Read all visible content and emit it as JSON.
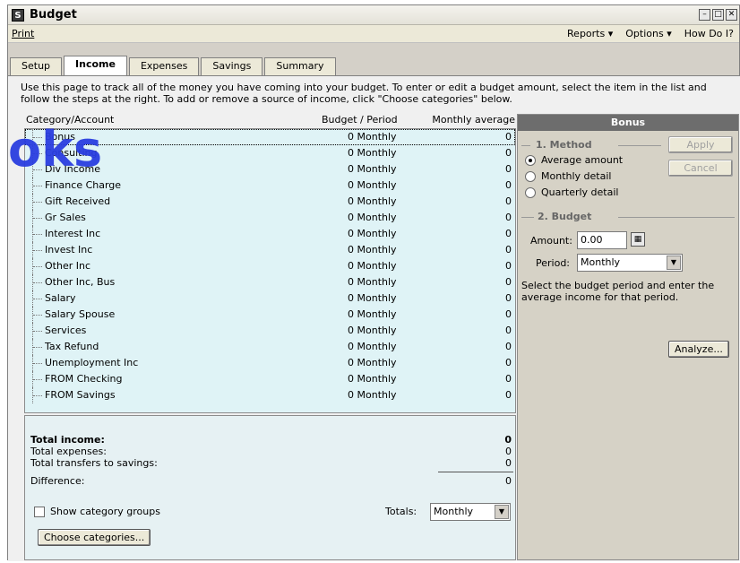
{
  "window": {
    "title": "Budget",
    "app_icon": "quicken-icon"
  },
  "menubar": {
    "print": "Print",
    "reports": "Reports ▾",
    "options": "Options ▾",
    "how_do_i": "How Do I?"
  },
  "tabs": [
    {
      "label": "Setup"
    },
    {
      "label": "Income"
    },
    {
      "label": "Expenses"
    },
    {
      "label": "Savings"
    },
    {
      "label": "Summary"
    }
  ],
  "instructions": "Use this page to track all of the money you have coming into your budget. To enter or edit a budget amount, select the item in the list and follow the steps at the right. To add or remove a source of income, click \"Choose categories\" below.",
  "watermark": "oks",
  "list": {
    "columns": {
      "category": "Category/Account",
      "budget": "Budget / Period",
      "average": "Monthly average"
    },
    "rows": [
      {
        "category": "Bonus",
        "budget": "0 Monthly",
        "average": "0"
      },
      {
        "category": "Consulting",
        "budget": "0 Monthly",
        "average": "0"
      },
      {
        "category": "Div Income",
        "budget": "0 Monthly",
        "average": "0"
      },
      {
        "category": "Finance Charge",
        "budget": "0 Monthly",
        "average": "0"
      },
      {
        "category": "Gift Received",
        "budget": "0 Monthly",
        "average": "0"
      },
      {
        "category": "Gr Sales",
        "budget": "0 Monthly",
        "average": "0"
      },
      {
        "category": "Interest Inc",
        "budget": "0 Monthly",
        "average": "0"
      },
      {
        "category": "Invest Inc",
        "budget": "0 Monthly",
        "average": "0"
      },
      {
        "category": "Other Inc",
        "budget": "0 Monthly",
        "average": "0"
      },
      {
        "category": "Other Inc, Bus",
        "budget": "0 Monthly",
        "average": "0"
      },
      {
        "category": "Salary",
        "budget": "0 Monthly",
        "average": "0"
      },
      {
        "category": "Salary Spouse",
        "budget": "0 Monthly",
        "average": "0"
      },
      {
        "category": "Services",
        "budget": "0 Monthly",
        "average": "0"
      },
      {
        "category": "Tax Refund",
        "budget": "0 Monthly",
        "average": "0"
      },
      {
        "category": "Unemployment Inc",
        "budget": "0 Monthly",
        "average": "0"
      },
      {
        "category": "FROM Checking",
        "budget": "0 Monthly",
        "average": "0"
      },
      {
        "category": "FROM Savings",
        "budget": "0 Monthly",
        "average": "0"
      }
    ]
  },
  "totals": {
    "income_label": "Total income:",
    "income_value": "0",
    "expenses_label": "Total expenses:",
    "expenses_value": "0",
    "transfers_label": "Total transfers to savings:",
    "transfers_value": "0",
    "difference_label": "Difference:",
    "difference_value": "0",
    "show_groups_label": "Show category groups",
    "totals_label": "Totals:",
    "totals_value": "Monthly",
    "choose_button": "Choose categories..."
  },
  "panel": {
    "header": "Bonus",
    "method_title": "1. Method",
    "method_options": [
      "Average amount",
      "Monthly detail",
      "Quarterly detail"
    ],
    "apply": "Apply",
    "cancel": "Cancel",
    "budget_title": "2. Budget",
    "amount_label": "Amount:",
    "amount_value": "0.00",
    "period_label": "Period:",
    "period_value": "Monthly",
    "help": "Select the budget period and enter the average income for that period.",
    "analyze": "Analyze..."
  }
}
